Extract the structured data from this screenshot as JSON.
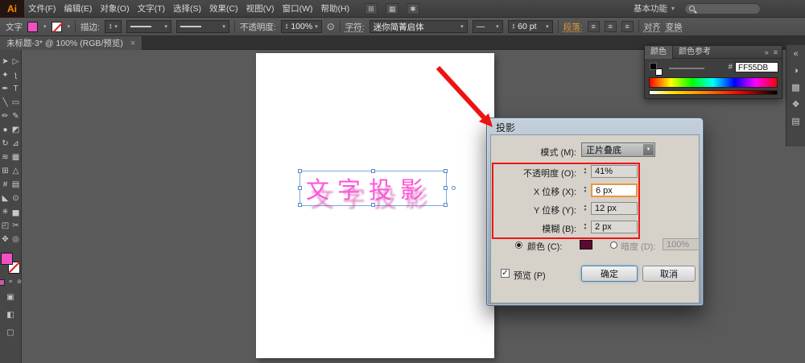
{
  "icons": {
    "caret_down": "▼",
    "caret_up": "▲",
    "caret_small": "▾",
    "double_right": "»",
    "panel_menu": "≡",
    "close": "×",
    "check": "✓",
    "align": "≡",
    "style_circle": "⊙"
  },
  "colors": {
    "text_pink": "#ff55db",
    "shadow_pink": "#c2188f",
    "annotation_red": "#ee1414",
    "fill_swatch": "#f24fc0",
    "dialog_color_chip": "#5c0a31"
  },
  "menubar": {
    "logo": "Ai",
    "workspace": "基本功能",
    "items": [
      {
        "name": "menu-file",
        "label": "文件(F)"
      },
      {
        "name": "menu-edit",
        "label": "编辑(E)"
      },
      {
        "name": "menu-object",
        "label": "对象(O)"
      },
      {
        "name": "menu-type",
        "label": "文字(T)"
      },
      {
        "name": "menu-select",
        "label": "选择(S)"
      },
      {
        "name": "menu-effect",
        "label": "效果(C)"
      },
      {
        "name": "menu-view",
        "label": "视图(V)"
      },
      {
        "name": "menu-window",
        "label": "窗口(W)"
      },
      {
        "name": "menu-help",
        "label": "帮助(H)"
      }
    ]
  },
  "appbar_icons": [
    {
      "name": "bridge-icon",
      "glyph": "⊞"
    },
    {
      "name": "arrange-documents-icon",
      "glyph": "▦"
    },
    {
      "name": "workspace-icon",
      "glyph": "✱"
    }
  ],
  "controlbar": {
    "target_label": "文字",
    "stroke_label": "描边:",
    "opacity_label": "不透明度:",
    "opacity_value": "100%",
    "character_label": "字符:",
    "font_name": "迷你简菁启体",
    "font_style": "—",
    "font_size": "60 pt",
    "paragraph_label": "段落:",
    "align_label": "对齐",
    "transform_label": "变换"
  },
  "document_tab": {
    "title": "未标题-3* @ 100% (RGB/预览)"
  },
  "toolbar": {
    "tools": [
      {
        "name": "selection-tool",
        "glyph": "➤"
      },
      {
        "name": "direct-selection-tool",
        "glyph": "▷"
      },
      {
        "name": "magic-wand-tool",
        "glyph": "✦"
      },
      {
        "name": "lasso-tool",
        "glyph": "ʅ"
      },
      {
        "name": "pen-tool",
        "glyph": "✒"
      },
      {
        "name": "type-tool",
        "glyph": "T"
      },
      {
        "name": "line-segment-tool",
        "glyph": "╲"
      },
      {
        "name": "rectangle-tool",
        "glyph": "▭"
      },
      {
        "name": "paintbrush-tool",
        "glyph": "✏"
      },
      {
        "name": "pencil-tool",
        "glyph": "✎"
      },
      {
        "name": "blob-brush-tool",
        "glyph": "●"
      },
      {
        "name": "eraser-tool",
        "glyph": "◩"
      },
      {
        "name": "rotate-tool",
        "glyph": "↻"
      },
      {
        "name": "scale-tool",
        "glyph": "⊿"
      },
      {
        "name": "width-tool",
        "glyph": "≋"
      },
      {
        "name": "free-transform-tool",
        "glyph": "▦"
      },
      {
        "name": "shape-builder-tool",
        "glyph": "⊞"
      },
      {
        "name": "perspective-grid-tool",
        "glyph": "△"
      },
      {
        "name": "mesh-tool",
        "glyph": "#"
      },
      {
        "name": "gradient-tool",
        "glyph": "▤"
      },
      {
        "name": "eyedropper-tool",
        "glyph": "◣"
      },
      {
        "name": "blend-tool",
        "glyph": "⊙"
      },
      {
        "name": "symbol-sprayer-tool",
        "glyph": "✳"
      },
      {
        "name": "column-graph-tool",
        "glyph": "▅"
      },
      {
        "name": "artboard-tool",
        "glyph": "◰"
      },
      {
        "name": "slice-tool",
        "glyph": "✂"
      },
      {
        "name": "hand-tool",
        "glyph": "✥"
      },
      {
        "name": "zoom-tool",
        "glyph": "◎"
      }
    ]
  },
  "canvas": {
    "text": "文字投影"
  },
  "color_panel": {
    "tab_color": "颜色",
    "tab_guide": "颜色参考",
    "hex_prefix": "#",
    "hex_value": "FF55DB"
  },
  "right_rail": {
    "icons": [
      {
        "name": "collapse-panels-icon",
        "glyph": "«"
      },
      {
        "name": "color-panel-icon",
        "glyph": "◑"
      },
      {
        "name": "color-guide-panel-icon",
        "glyph": "▩"
      },
      {
        "name": "appearance-panel-icon",
        "glyph": "❖"
      },
      {
        "name": "layers-panel-icon",
        "glyph": "▤"
      }
    ]
  },
  "dialog": {
    "title": "投影",
    "mode_label": "模式 (M):",
    "mode_value": "正片叠底",
    "opacity_label": "不透明度 (O):",
    "opacity_value": "41%",
    "x_label": "X 位移 (X):",
    "x_value": "6 px",
    "y_label": "Y 位移 (Y):",
    "y_value": "12 px",
    "blur_label": "模糊 (B):",
    "blur_value": "2 px",
    "color_label": "颜色 (C):",
    "darkness_label": "暗度 (D):",
    "darkness_value": "100%",
    "preview_label": "预览 (P)",
    "ok_label": "确定",
    "cancel_label": "取消"
  }
}
